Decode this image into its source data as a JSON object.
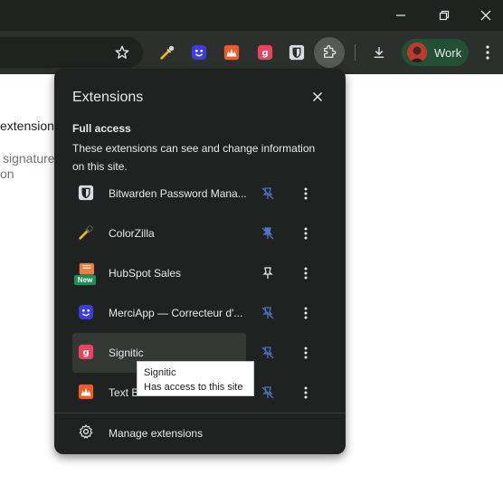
{
  "colors": {
    "titlebar": "#1f2320",
    "toolbar": "#2b302c",
    "popup_bg": "#1f2220",
    "profile_chip": "#234f35",
    "text_primary": "#e8eaed",
    "pinned_icon": "#e8eaed",
    "unpinned_icon": "#4d74c7"
  },
  "window_controls": [
    "minimize-icon",
    "restore-icon",
    "close-icon"
  ],
  "toolbar": {
    "icons": [
      "star-icon",
      "colorzilla-eyedropper-icon",
      "merciapp-icon",
      "text-blaze-icon",
      "signitic-icon",
      "bitwarden-icon",
      "extensions-puzzle-icon",
      "download-icon",
      "more-menu-icon"
    ],
    "profile_label": "Work"
  },
  "page_background": {
    "fragments": [
      "extension",
      "signature",
      "on"
    ]
  },
  "popup": {
    "title": "Extensions",
    "section_title": "Full access",
    "section_desc": "These extensions can see and change information on this site.",
    "extensions": [
      {
        "name": "Bitwarden Password Mana...",
        "icon": "bitwarden-icon",
        "pinned": false,
        "icon_color": "#dadce0"
      },
      {
        "name": "ColorZilla",
        "icon": "colorzilla-eyedropper-icon",
        "pinned": false,
        "icon_color": "#1a1a1a"
      },
      {
        "name": "HubSpot Sales",
        "icon": "hubspot-icon",
        "pinned": true,
        "icon_color": "#ef7d3c",
        "badge": "New"
      },
      {
        "name": "MerciApp — Correcteur d'...",
        "icon": "merciapp-icon",
        "pinned": false,
        "icon_color": "#3b3fd8"
      },
      {
        "name": "Signitic",
        "icon": "signitic-icon",
        "pinned": false,
        "icon_color": "#e9435e",
        "hovered": true
      },
      {
        "name": "Text B",
        "icon": "text-blaze-icon",
        "pinned": false,
        "icon_color": "#f05b28"
      }
    ],
    "manage_label": "Manage extensions"
  },
  "tooltip": {
    "line1": "Signitic",
    "line2": "Has access to this site"
  }
}
